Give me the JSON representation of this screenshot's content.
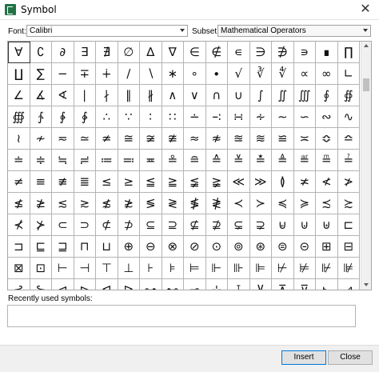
{
  "window": {
    "title": "Symbol",
    "close_glyph": "✕"
  },
  "font": {
    "label": "Font:",
    "value": "Calibri"
  },
  "subset": {
    "label": "Subset:",
    "value": "Mathematical Operators"
  },
  "symbols": [
    "∀",
    "∁",
    "∂",
    "∃",
    "∄",
    "∅",
    "∆",
    "∇",
    "∈",
    "∉",
    "∊",
    "∋",
    "∌",
    "∍",
    "∎",
    "∏",
    "∐",
    "∑",
    "−",
    "∓",
    "∔",
    "∕",
    "∖",
    "∗",
    "∘",
    "∙",
    "√",
    "∛",
    "∜",
    "∝",
    "∞",
    "∟",
    "∠",
    "∡",
    "∢",
    "∣",
    "∤",
    "∥",
    "∦",
    "∧",
    "∨",
    "∩",
    "∪",
    "∫",
    "∬",
    "∭",
    "∮",
    "∯",
    "∰",
    "∱",
    "∲",
    "∳",
    "∴",
    "∵",
    "∶",
    "∷",
    "∸",
    "∹",
    "∺",
    "∻",
    "∼",
    "∽",
    "∾",
    "∿",
    "≀",
    "≁",
    "≂",
    "≃",
    "≄",
    "≅",
    "≆",
    "≇",
    "≈",
    "≉",
    "≊",
    "≋",
    "≌",
    "≍",
    "≎",
    "≏",
    "≐",
    "≑",
    "≒",
    "≓",
    "≔",
    "≕",
    "≖",
    "≗",
    "≘",
    "≙",
    "≚",
    "≛",
    "≜",
    "≝",
    "≞",
    "≟",
    "≠",
    "≡",
    "≢",
    "≣",
    "≤",
    "≥",
    "≦",
    "≧",
    "≨",
    "≩",
    "≪",
    "≫",
    "≬",
    "≭",
    "≮",
    "≯",
    "≰",
    "≱",
    "≲",
    "≳",
    "≴",
    "≵",
    "≶",
    "≷",
    "≸",
    "≹",
    "≺",
    "≻",
    "≼",
    "≽",
    "≾",
    "≿",
    "⊀",
    "⊁",
    "⊂",
    "⊃",
    "⊄",
    "⊅",
    "⊆",
    "⊇",
    "⊈",
    "⊉",
    "⊊",
    "⊋",
    "⊌",
    "⊍",
    "⊎",
    "⊏",
    "⊐",
    "⊑",
    "⊒",
    "⊓",
    "⊔",
    "⊕",
    "⊖",
    "⊗",
    "⊘",
    "⊙",
    "⊚",
    "⊛",
    "⊜",
    "⊝",
    "⊞",
    "⊟",
    "⊠",
    "⊡",
    "⊢",
    "⊣",
    "⊤",
    "⊥",
    "⊦",
    "⊧",
    "⊨",
    "⊩",
    "⊪",
    "⊫",
    "⊬",
    "⊭",
    "⊮",
    "⊯",
    "⊰",
    "⊱",
    "⊲",
    "⊳",
    "⊴",
    "⊵",
    "⊶",
    "⊷",
    "⊸",
    "⊹",
    "⊺",
    "⊻",
    "⊼",
    "⊽",
    "⊾",
    "⊿"
  ],
  "recent": {
    "label": "Recently used symbols:"
  },
  "buttons": {
    "insert": "Insert",
    "close": "Close"
  }
}
